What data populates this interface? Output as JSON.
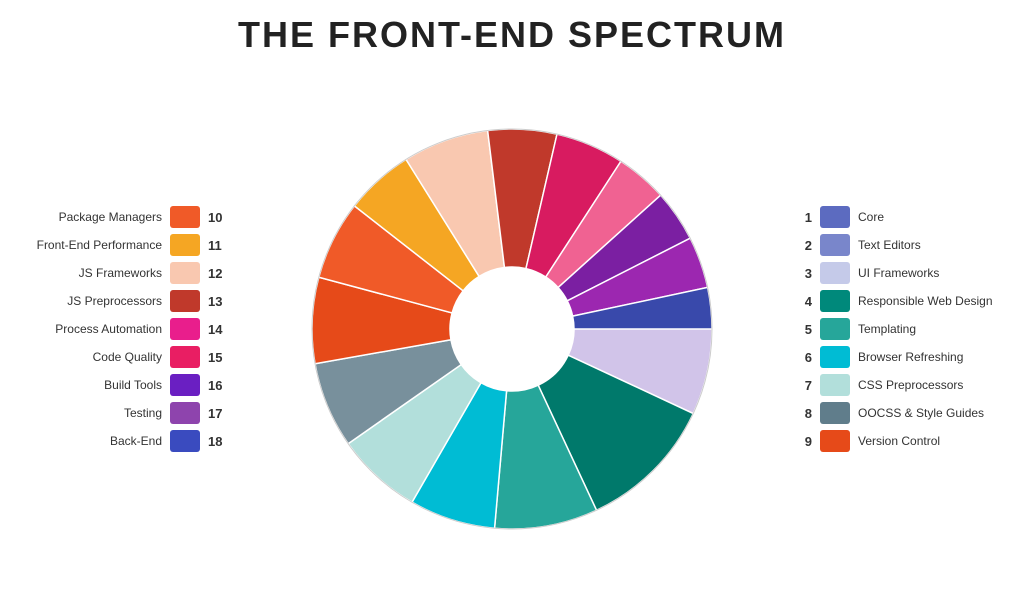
{
  "title": "THE FRONT-END SPECTRUM",
  "left_legend": [
    {
      "label": "Package Managers",
      "number": "10",
      "color": "#f05a28"
    },
    {
      "label": "Front-End Performance",
      "number": "11",
      "color": "#f5a623"
    },
    {
      "label": "JS Frameworks",
      "number": "12",
      "color": "#f9c8b0"
    },
    {
      "label": "JS Preprocessors",
      "number": "13",
      "color": "#c0392b"
    },
    {
      "label": "Process Automation",
      "number": "14",
      "color": "#e91e8c"
    },
    {
      "label": "Code Quality",
      "number": "15",
      "color": "#e91e63"
    },
    {
      "label": "Build Tools",
      "number": "16",
      "color": "#6a1fc2"
    },
    {
      "label": "Testing",
      "number": "17",
      "color": "#8e44ad"
    },
    {
      "label": "Back-End",
      "number": "18",
      "color": "#3a4bbf"
    }
  ],
  "right_legend": [
    {
      "label": "Core",
      "number": "1",
      "color": "#5c6bc0"
    },
    {
      "label": "Text Editors",
      "number": "2",
      "color": "#7986cb"
    },
    {
      "label": "UI Frameworks",
      "number": "3",
      "color": "#c5cae9"
    },
    {
      "label": "Responsible Web Design",
      "number": "4",
      "color": "#00897b"
    },
    {
      "label": "Templating",
      "number": "5",
      "color": "#26a69a"
    },
    {
      "label": "Browser Refreshing",
      "number": "6",
      "color": "#00bcd4"
    },
    {
      "label": "CSS Preprocessors",
      "number": "7",
      "color": "#b2dfdb"
    },
    {
      "label": "OOCSS & Style Guides",
      "number": "8",
      "color": "#607d8b"
    },
    {
      "label": "Version Control",
      "number": "9",
      "color": "#e64a19"
    }
  ],
  "wheel": {
    "segments": [
      {
        "id": 1,
        "color": "#5c6bc0",
        "startAngle": -90,
        "sweep": 40
      },
      {
        "id": 2,
        "color": "#7986cb",
        "startAngle": -50,
        "sweep": 40
      },
      {
        "id": 3,
        "color": "#c5cae9",
        "startAngle": -10,
        "sweep": 35
      },
      {
        "id": 4,
        "color": "#00897b",
        "startAngle": 25,
        "sweep": 40
      },
      {
        "id": 5,
        "color": "#26a69a",
        "startAngle": 65,
        "sweep": 30
      },
      {
        "id": 6,
        "color": "#00bcd4",
        "startAngle": 95,
        "sweep": 25
      },
      {
        "id": 7,
        "color": "#80cbc4",
        "startAngle": 120,
        "sweep": 25
      },
      {
        "id": 8,
        "color": "#607d8b",
        "startAngle": 145,
        "sweep": 25
      },
      {
        "id": 9,
        "color": "#e64a19",
        "startAngle": 170,
        "sweep": 25
      },
      {
        "id": 10,
        "color": "#f05a28",
        "startAngle": 195,
        "sweep": 25
      },
      {
        "id": 11,
        "color": "#f5a623",
        "startAngle": 220,
        "sweep": 20
      },
      {
        "id": 12,
        "color": "#f9c8b0",
        "startAngle": 240,
        "sweep": 25
      },
      {
        "id": 13,
        "color": "#c0392b",
        "startAngle": 265,
        "sweep": 25
      },
      {
        "id": 14,
        "color": "#e91e8c",
        "startAngle": -70,
        "sweep": 25
      },
      {
        "id": 15,
        "color": "#e91e63",
        "startAngle": -65,
        "sweep": 20
      },
      {
        "id": 16,
        "color": "#6a1fc2",
        "startAngle": -110,
        "sweep": 30
      },
      {
        "id": 17,
        "color": "#8e44ad",
        "startAngle": -135,
        "sweep": 25
      },
      {
        "id": 18,
        "color": "#3a4bbf",
        "startAngle": -120,
        "sweep": 25
      }
    ]
  }
}
